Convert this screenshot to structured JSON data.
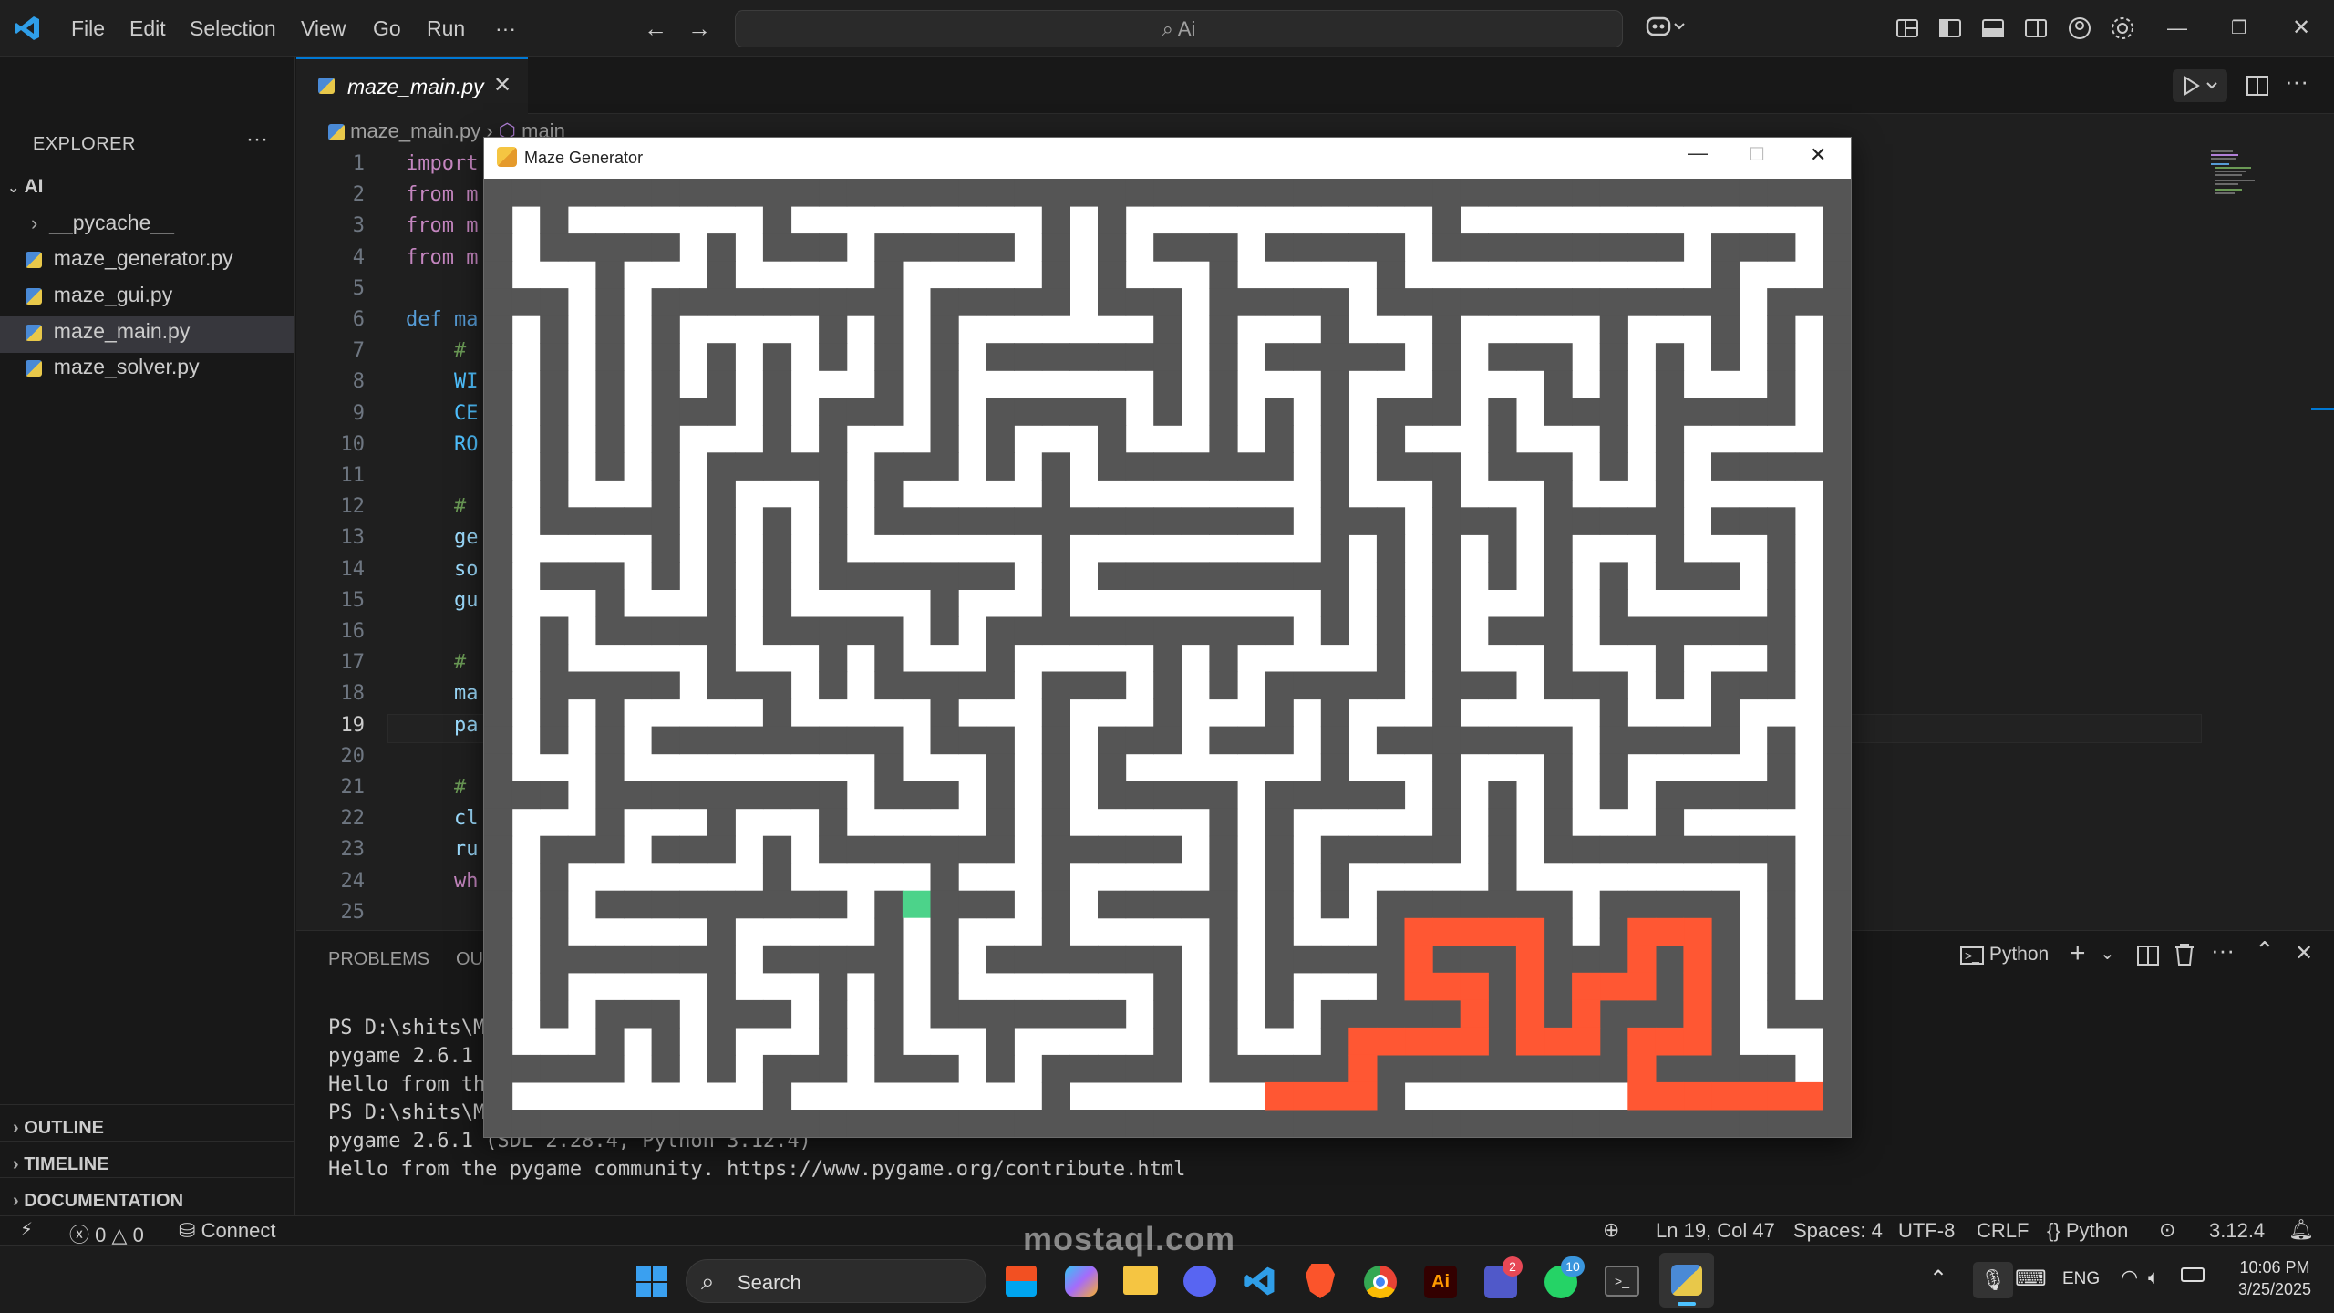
{
  "titlebar": {
    "menu": [
      "File",
      "Edit",
      "Selection",
      "View",
      "Go",
      "Run",
      "···"
    ],
    "search": "Ai"
  },
  "explorer": {
    "title": "EXPLORER",
    "root": "AI",
    "items": [
      {
        "label": "__pycache__",
        "type": "folder"
      },
      {
        "label": "maze_generator.py",
        "type": "file"
      },
      {
        "label": "maze_gui.py",
        "type": "file"
      },
      {
        "label": "maze_main.py",
        "type": "file",
        "selected": true
      },
      {
        "label": "maze_solver.py",
        "type": "file"
      }
    ],
    "sections": [
      "OUTLINE",
      "TIMELINE",
      "DOCUMENTATION"
    ]
  },
  "editor": {
    "tab": "maze_main.py",
    "breadcrumb": [
      "maze_main.py",
      "main"
    ],
    "lines": [
      {
        "n": "1",
        "text": "import",
        "color": "#c586c0"
      },
      {
        "n": "2",
        "text": "from m",
        "color": "#c586c0"
      },
      {
        "n": "3",
        "text": "from m",
        "color": "#c586c0"
      },
      {
        "n": "4",
        "text": "from m",
        "color": "#c586c0"
      },
      {
        "n": "5",
        "text": "",
        "color": "#cccccc"
      },
      {
        "n": "6",
        "text": "def ma",
        "color": "#569cd6"
      },
      {
        "n": "7",
        "text": "    #",
        "color": "#6a9955"
      },
      {
        "n": "8",
        "text": "    WI",
        "color": "#4fc1ff"
      },
      {
        "n": "9",
        "text": "    CE",
        "color": "#4fc1ff"
      },
      {
        "n": "10",
        "text": "    RO",
        "color": "#4fc1ff"
      },
      {
        "n": "11",
        "text": "",
        "color": "#cccccc"
      },
      {
        "n": "12",
        "text": "    #",
        "color": "#6a9955"
      },
      {
        "n": "13",
        "text": "    ge",
        "color": "#9cdcfe"
      },
      {
        "n": "14",
        "text": "    so",
        "color": "#9cdcfe"
      },
      {
        "n": "15",
        "text": "    gu",
        "color": "#9cdcfe"
      },
      {
        "n": "16",
        "text": "",
        "color": "#cccccc"
      },
      {
        "n": "17",
        "text": "    #",
        "color": "#6a9955"
      },
      {
        "n": "18",
        "text": "    ma",
        "color": "#9cdcfe"
      },
      {
        "n": "19",
        "text": "    pa",
        "color": "#9cdcfe"
      },
      {
        "n": "20",
        "text": "",
        "color": "#cccccc"
      },
      {
        "n": "21",
        "text": "    #",
        "color": "#6a9955"
      },
      {
        "n": "22",
        "text": "    cl",
        "color": "#9cdcfe"
      },
      {
        "n": "23",
        "text": "    ru",
        "color": "#9cdcfe"
      },
      {
        "n": "24",
        "text": "    wh",
        "color": "#c586c0"
      },
      {
        "n": "25",
        "text": "",
        "color": "#cccccc"
      }
    ]
  },
  "panel": {
    "tabs": [
      "PROBLEMS",
      "OU"
    ],
    "terminal_label": "Python",
    "terminal": [
      "PS D:\\shits\\M",
      "pygame 2.6.1",
      "Hello from th",
      "PS D:\\shits\\M",
      "pygame 2.6.1 (SDL 2.28.4, Python 3.12.4)",
      "Hello from the pygame community. https://www.pygame.org/contribute.html"
    ]
  },
  "statusbar": {
    "errors": "0",
    "warnings": "0",
    "connect": "Connect",
    "position": "Ln 19, Col 47",
    "spaces": "Spaces: 4",
    "encoding": "UTF-8",
    "eol": "CRLF",
    "language": "Python",
    "version": "3.12.4"
  },
  "pygame_window": {
    "title": "Maze Generator",
    "colors": {
      "wall": "#555555",
      "path": "#ff5733",
      "start": "#4cd38a",
      "floor": "#ffffff"
    }
  },
  "taskbar": {
    "search": "Search",
    "lang": "ENG",
    "time": "10:06 PM",
    "date": "3/25/2025",
    "badges": {
      "teams": "2",
      "whatsapp": "10"
    }
  },
  "watermark": "mostaql.com"
}
